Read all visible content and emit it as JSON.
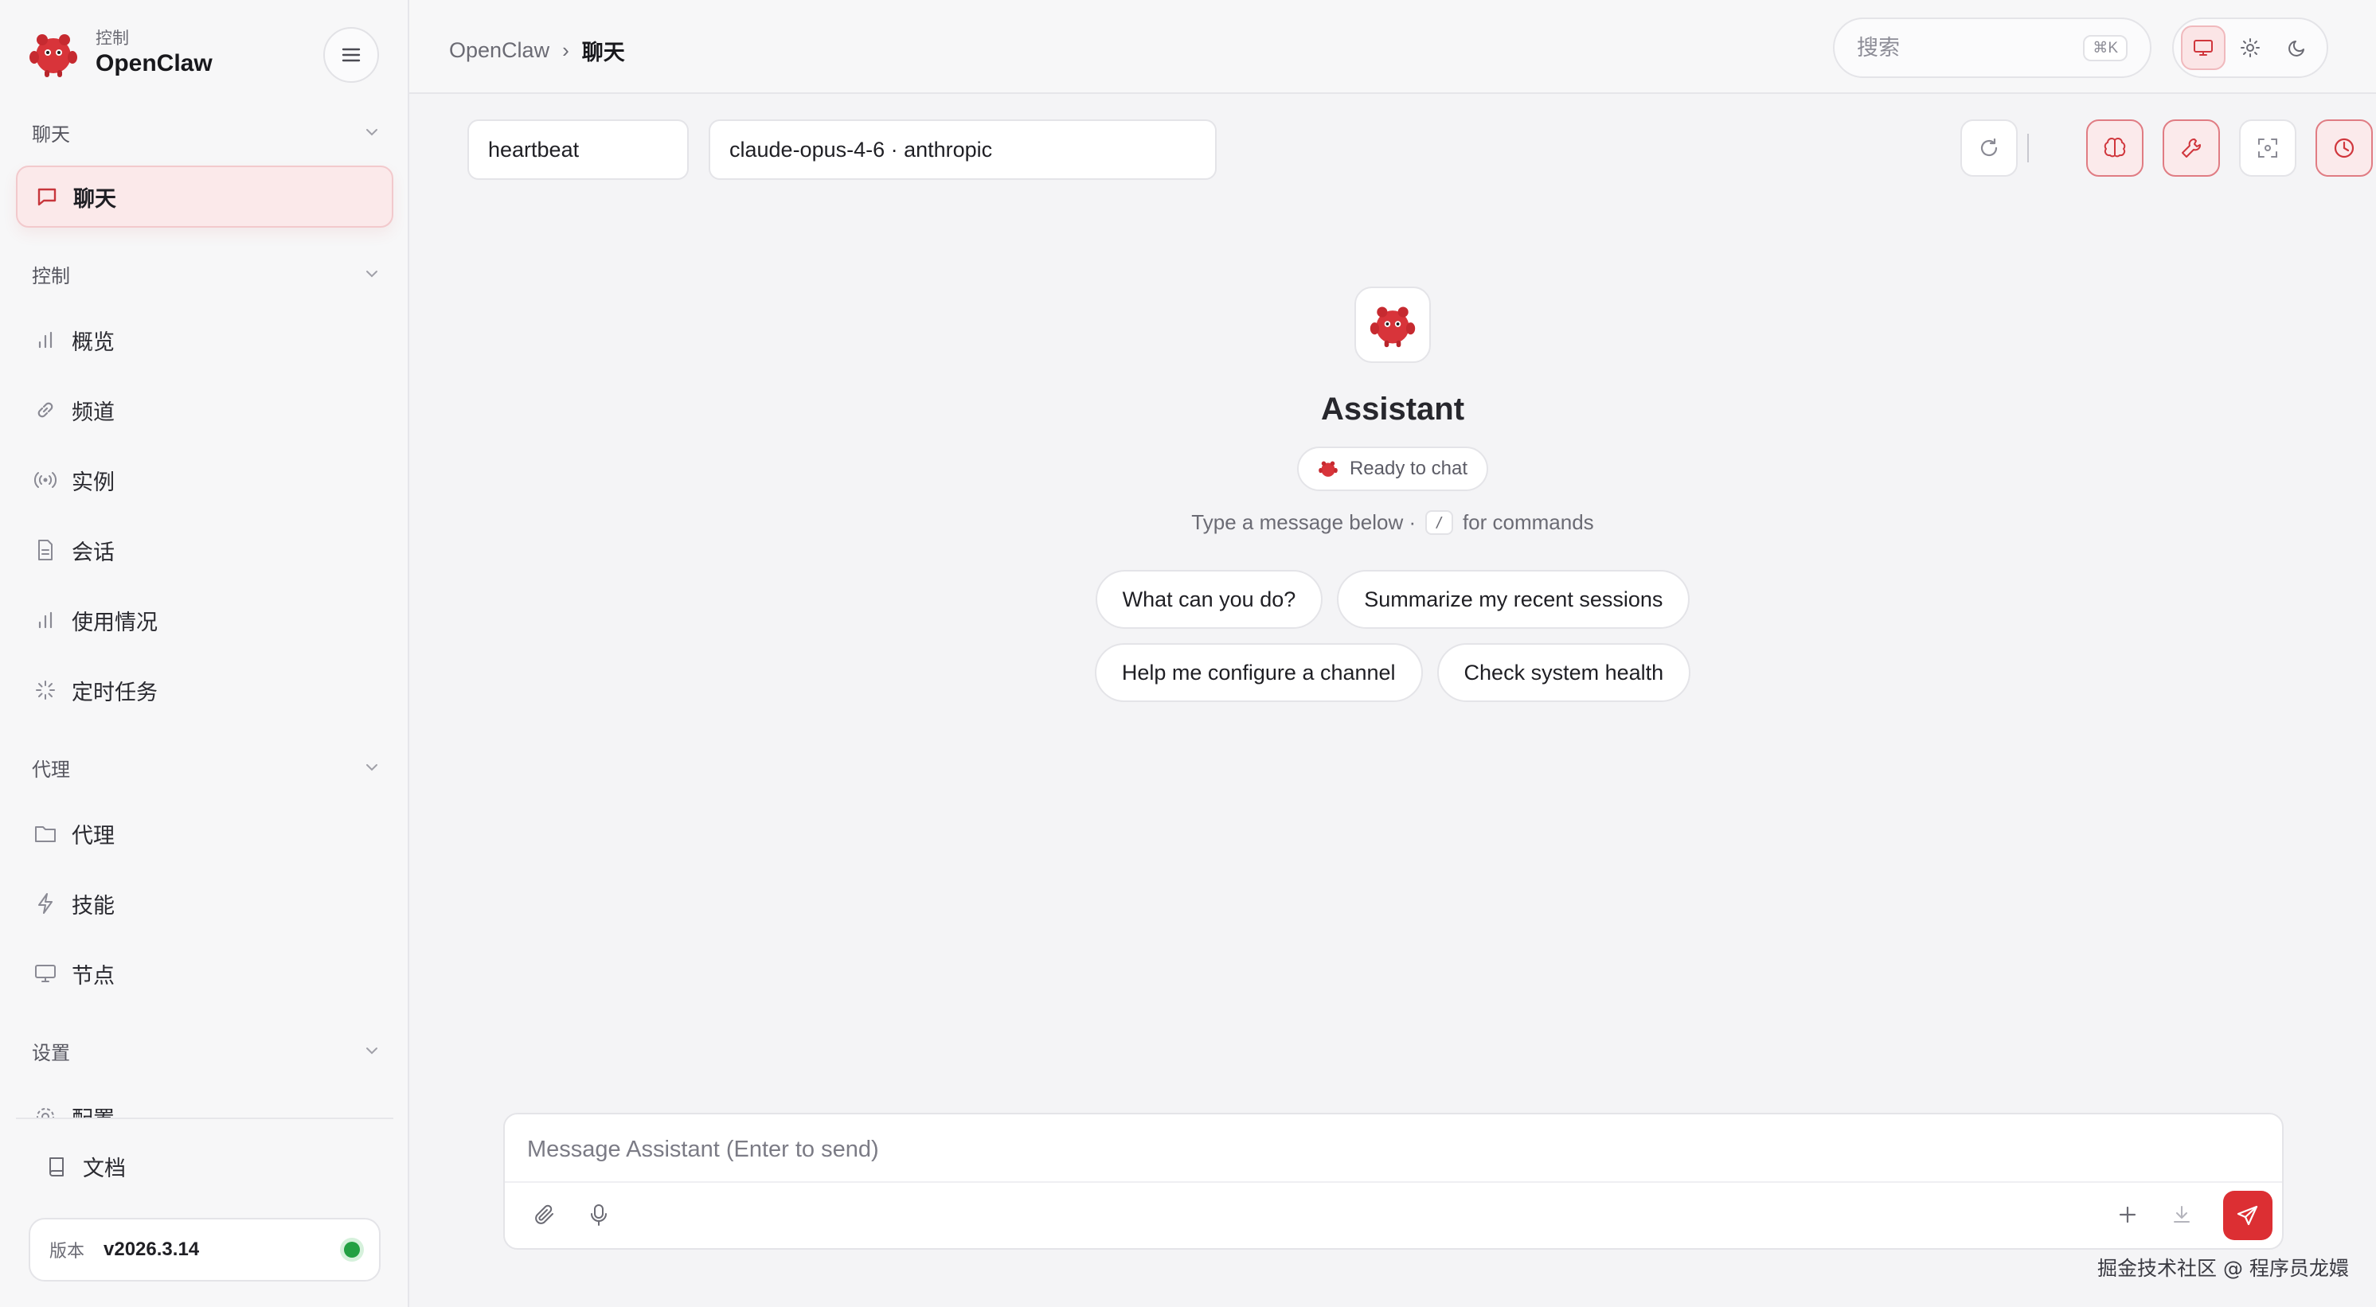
{
  "brand": {
    "subtitle": "控制",
    "name": "OpenClaw"
  },
  "sidebar": {
    "groups": [
      {
        "label": "聊天",
        "items": [
          {
            "label": "聊天",
            "icon": "message-square-icon",
            "active": true
          }
        ]
      },
      {
        "label": "控制",
        "items": [
          {
            "label": "概览",
            "icon": "bar-chart-icon"
          },
          {
            "label": "频道",
            "icon": "link-icon"
          },
          {
            "label": "实例",
            "icon": "radio-signal-icon"
          },
          {
            "label": "会话",
            "icon": "file-text-icon"
          },
          {
            "label": "使用情况",
            "icon": "bar-chart-icon"
          },
          {
            "label": "定时任务",
            "icon": "loader-icon"
          }
        ]
      },
      {
        "label": "代理",
        "items": [
          {
            "label": "代理",
            "icon": "folder-icon"
          },
          {
            "label": "技能",
            "icon": "zap-icon"
          },
          {
            "label": "节点",
            "icon": "monitor-icon"
          }
        ]
      },
      {
        "label": "设置",
        "items": [
          {
            "label": "配置",
            "icon": "settings-icon"
          }
        ]
      }
    ],
    "docs_label": "文档",
    "version_label": "版本",
    "version_value": "v2026.3.14"
  },
  "header": {
    "breadcrumb_root": "OpenClaw",
    "breadcrumb_sep": "›",
    "breadcrumb_current": "聊天",
    "search_placeholder": "搜索",
    "search_shortcut": "⌘K"
  },
  "toolbar": {
    "session_value": "heartbeat",
    "model_value": "claude-opus-4-6 · anthropic",
    "separator": "|"
  },
  "chat": {
    "assistant_name": "Assistant",
    "status": "Ready to chat",
    "hint_prefix": "Type a message below ·",
    "hint_key": "/",
    "hint_suffix": "for commands",
    "suggestions": [
      "What can you do?",
      "Summarize my recent sessions",
      "Help me configure a channel",
      "Check system health"
    ]
  },
  "composer": {
    "placeholder": "Message Assistant (Enter to send)"
  },
  "colors": {
    "accent": "#dc2f33",
    "active_bg": "#fbe9ea",
    "online": "#23a043"
  },
  "watermark": "掘金技术社区 @ 程序员龙嬛"
}
